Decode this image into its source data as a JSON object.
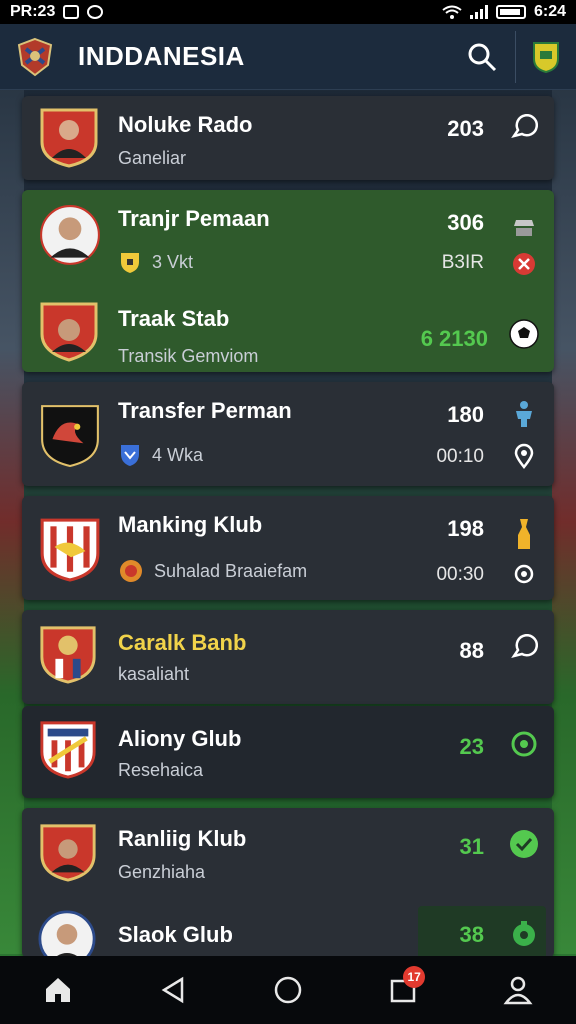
{
  "status": {
    "left_time": "PR:23",
    "right_time": "6:24"
  },
  "app": {
    "title": "INDDANESIA"
  },
  "rows": [
    {
      "name": "Noluke Rado",
      "sub": "Ganeliar",
      "value": "203"
    },
    {
      "name": "Tranjr Pemaan",
      "sub": "3 Vkt",
      "value": "306",
      "value2": "B3IR"
    },
    {
      "name": "Traak Stab",
      "sub": "Transik Gemviom",
      "value": "6 2130"
    },
    {
      "name": "Transfer Perman",
      "sub": "4 Wka",
      "value": "180",
      "value2": "00:10"
    },
    {
      "name": "Manking Klub",
      "sub": "Suhalad Braaiefam",
      "value": "198",
      "value2": "00:30"
    },
    {
      "name": "Caralk Banb",
      "sub": "kasaliaht",
      "value": "88"
    },
    {
      "name": "Aliony Glub",
      "sub": "Resehaica",
      "value": "23"
    },
    {
      "name": "Ranliig Klub",
      "sub": "Genzhiaha",
      "value": "31"
    },
    {
      "name": "Slaok Glub",
      "sub": "",
      "value": "38"
    }
  ],
  "nav": {
    "notifications_badge": "17"
  },
  "colors": {
    "accent_green": "#54c94f",
    "highlight_bg": "#2f5a2c",
    "badge_red": "#e23a2f",
    "title_yellow": "#f1d34a"
  }
}
